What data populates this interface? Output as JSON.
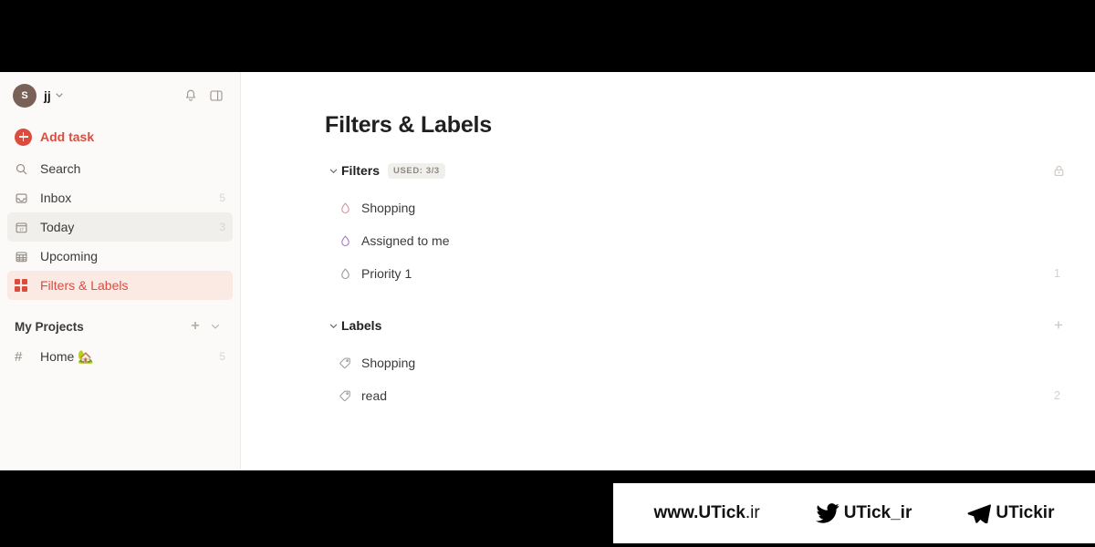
{
  "sidebar": {
    "account": {
      "avatar_initial": "S",
      "user_name": "jj",
      "chevron": "⌄"
    },
    "header_icons": [
      {
        "name": "notifications-bell-icon",
        "label": "Notifications"
      },
      {
        "name": "sidebar-toggle-icon",
        "label": "Toggle sidebar"
      }
    ],
    "add_task_label": "Add task",
    "nav_items": [
      {
        "label": "Search",
        "count": "",
        "icon": "search-icon",
        "state": "normal"
      },
      {
        "label": "Inbox",
        "count": "5",
        "icon": "inbox-icon",
        "state": "normal"
      },
      {
        "label": "Today",
        "count": "3",
        "icon": "calendar-today-icon",
        "state": "hovered"
      },
      {
        "label": "Upcoming",
        "count": "",
        "icon": "calendar-upcoming-icon",
        "state": "normal"
      },
      {
        "label": "Filters & Labels",
        "count": "",
        "icon": "filters-labels-icon",
        "state": "active"
      }
    ],
    "projects": {
      "title": "My Projects",
      "add_label": "+",
      "collapse_label": "⌄",
      "items": [
        {
          "label": "Home 🏡",
          "count": "5",
          "icon": "hash-icon"
        }
      ]
    }
  },
  "main": {
    "page_title": "Filters & Labels",
    "filters_section": {
      "caret": "⌄",
      "title": "Filters",
      "badge": "USED: 3/3",
      "action_icon": "lock-icon",
      "items": [
        {
          "label": "Shopping",
          "count": "",
          "icon": "filter-drop-icon",
          "color": "#e08a99"
        },
        {
          "label": "Assigned to me",
          "count": "",
          "icon": "filter-drop-icon",
          "color": "#a970c9"
        },
        {
          "label": "Priority 1",
          "count": "1",
          "icon": "filter-drop-icon",
          "color": "#9b9690"
        }
      ]
    },
    "labels_section": {
      "caret": "⌄",
      "title": "Labels",
      "action_icon": "add-label-icon",
      "action_label": "+",
      "items": [
        {
          "label": "Shopping",
          "count": "",
          "icon": "tag-icon"
        },
        {
          "label": "read",
          "count": "2",
          "icon": "tag-icon"
        }
      ]
    }
  },
  "watermark": {
    "site": "www.UTick",
    "site_tld": ".ir",
    "twitter_handle": "UTick_ir",
    "telegram_handle": "UTickir"
  },
  "theme": {
    "accent_red": "#dc4c3e",
    "active_bg": "#fbe9e4",
    "sidebar_bg": "#fcfaf8",
    "text_primary": "#202020"
  }
}
